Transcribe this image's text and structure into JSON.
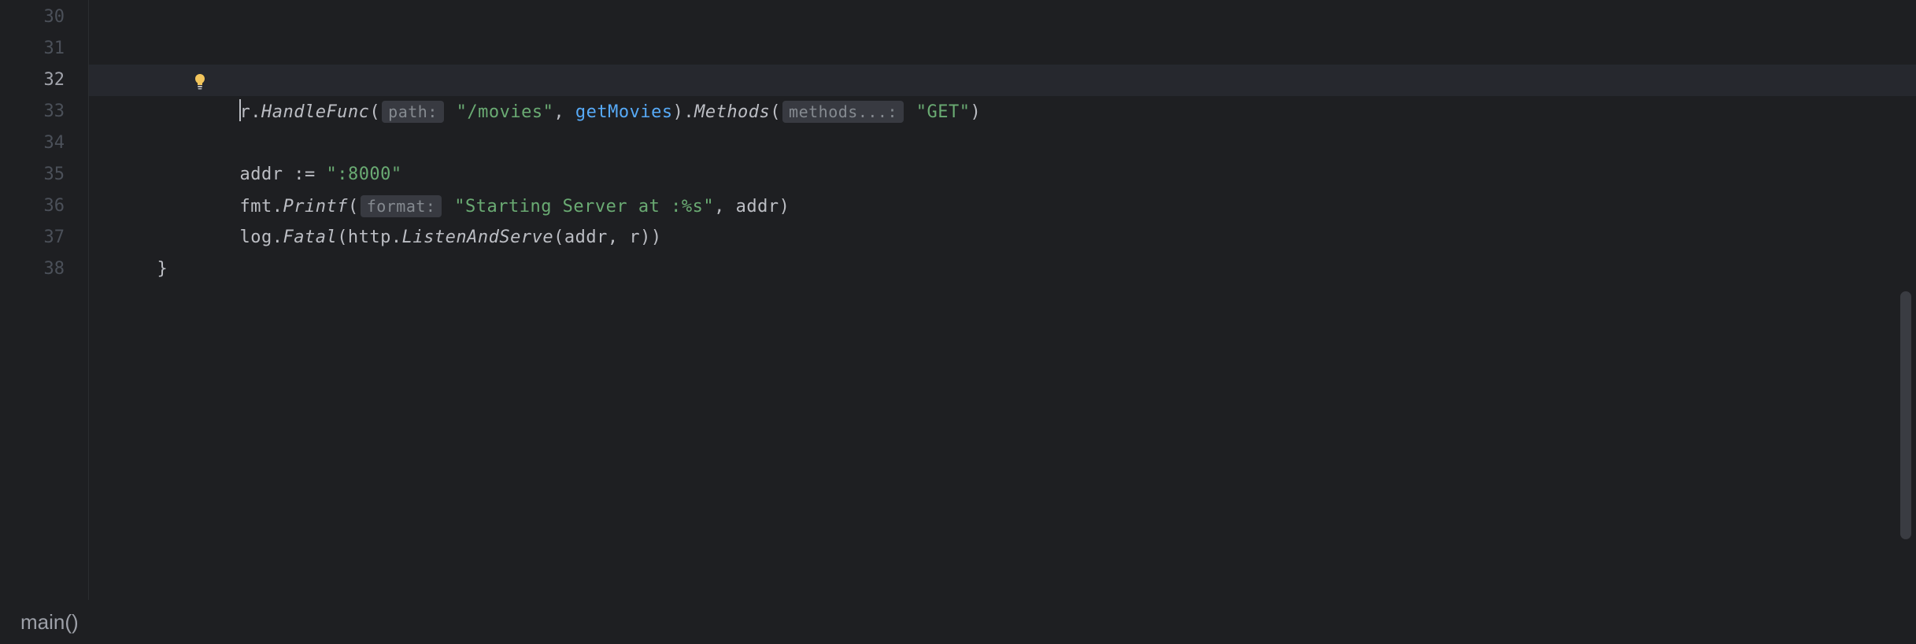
{
  "gutter": {
    "lines": [
      "30",
      "31",
      "32",
      "33",
      "34",
      "35",
      "36",
      "37",
      "38"
    ],
    "activeLine": "32"
  },
  "icons": {
    "bulb": "lightbulb-icon"
  },
  "code": {
    "line31": {
      "prefix": "    r.",
      "method1": "HandleFunc",
      "paren1": "(",
      "hint1": "path:",
      "space1": " ",
      "str1": "\"/movies\"",
      "comma1": ", ",
      "func": "getMovies",
      "paren2": ").",
      "method2": "Methods",
      "paren3": "(",
      "hint2": "methods...:",
      "space2": " ",
      "str2": "\"GET\"",
      "paren4": ")"
    },
    "line32_indent": "    ",
    "line34": {
      "prefix": "    addr ",
      "op": ":=",
      "space": " ",
      "str": "\":8000\""
    },
    "line35": {
      "prefix": "    fmt.",
      "method": "Printf",
      "paren1": "(",
      "hint": "format:",
      "space": " ",
      "str": "\"Starting Server at :%s\"",
      "rest": ", addr)"
    },
    "line36": {
      "prefix": "    log.",
      "method": "Fatal",
      "rest1": "(http.",
      "method2": "ListenAndServe",
      "rest2": "(addr, r))"
    },
    "line37": "}"
  },
  "breadcrumb": "main()"
}
